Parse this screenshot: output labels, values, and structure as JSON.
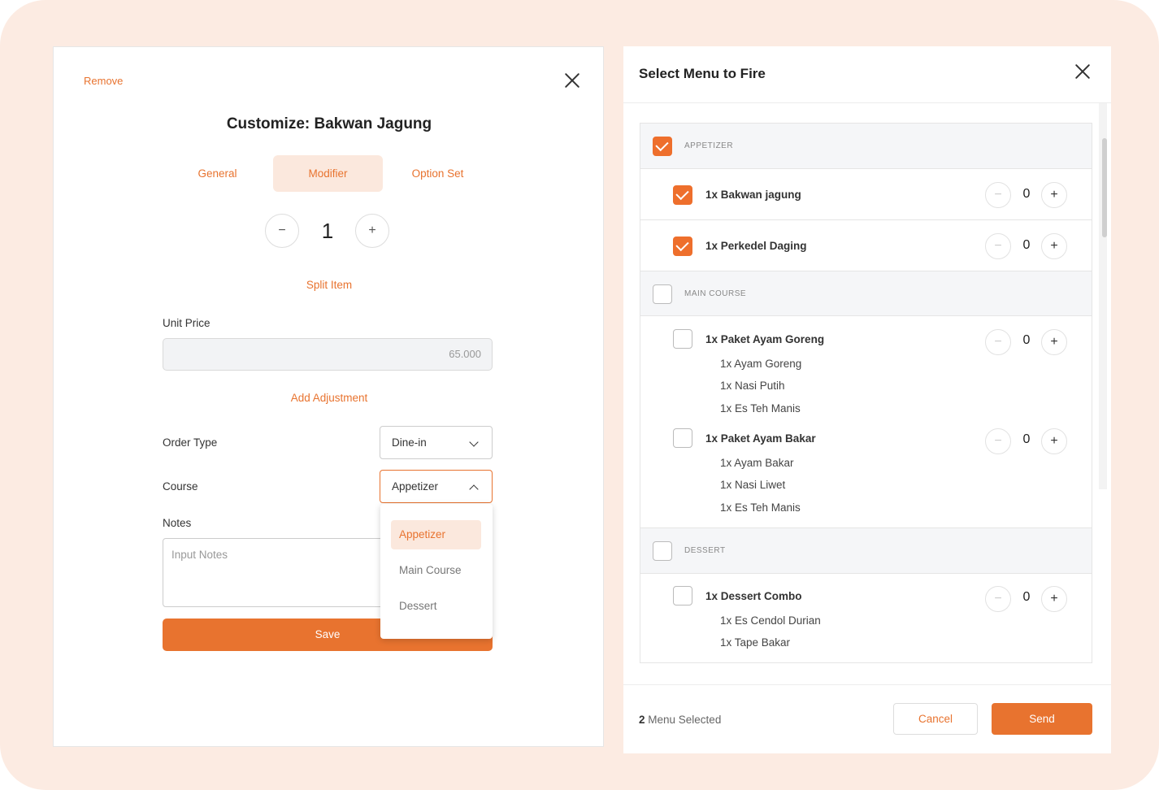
{
  "customize": {
    "remove_label": "Remove",
    "title": "Customize: Bakwan Jagung",
    "tabs": [
      {
        "label": "General",
        "active": false
      },
      {
        "label": "Modifier",
        "active": true
      },
      {
        "label": "Option Set",
        "active": false
      }
    ],
    "quantity": "1",
    "minus_label": "−",
    "plus_label": "+",
    "split_item_label": "Split Item",
    "unit_price_label": "Unit Price",
    "unit_price_value": "65.000",
    "add_adjustment_label": "Add Adjustment",
    "order_type_label": "Order Type",
    "order_type_value": "Dine-in",
    "course_label": "Course",
    "course_value": "Appetizer",
    "notes_label": "Notes",
    "notes_placeholder": "Input Notes",
    "save_label": "Save",
    "course_options": [
      "Appetizer",
      "Main Course",
      "Dessert"
    ],
    "course_selected": "Appetizer"
  },
  "fire": {
    "title": "Select Menu to Fire",
    "categories": [
      {
        "label": "APPETIZER",
        "checked": true,
        "items": [
          {
            "name": "1x Bakwan jagung",
            "checked": true,
            "qty": "0",
            "subs": []
          },
          {
            "name": "1x Perkedel Daging",
            "checked": true,
            "qty": "0",
            "subs": []
          }
        ]
      },
      {
        "label": "MAIN COURSE",
        "checked": false,
        "items": [
          {
            "name": "1x Paket Ayam Goreng",
            "checked": false,
            "qty": "0",
            "subs": [
              "1x Ayam Goreng",
              "1x Nasi Putih",
              "1x Es Teh Manis"
            ]
          },
          {
            "name": "1x Paket Ayam Bakar",
            "checked": false,
            "qty": "0",
            "subs": [
              "1x Ayam Bakar",
              "1x Nasi Liwet",
              "1x Es Teh Manis"
            ]
          }
        ]
      },
      {
        "label": "DESSERT",
        "checked": false,
        "items": [
          {
            "name": "1x Dessert Combo",
            "checked": false,
            "qty": "0",
            "subs": [
              "1x Es Cendol Durian",
              "1x Tape Bakar"
            ]
          }
        ]
      }
    ],
    "minus_label": "−",
    "plus_label": "+",
    "selected_count": "2",
    "selected_suffix": " Menu Selected",
    "cancel_label": "Cancel",
    "send_label": "Send"
  },
  "colors": {
    "accent": "#e8732f",
    "accent_light": "#fbe8dd",
    "background": "#fcebe2"
  }
}
